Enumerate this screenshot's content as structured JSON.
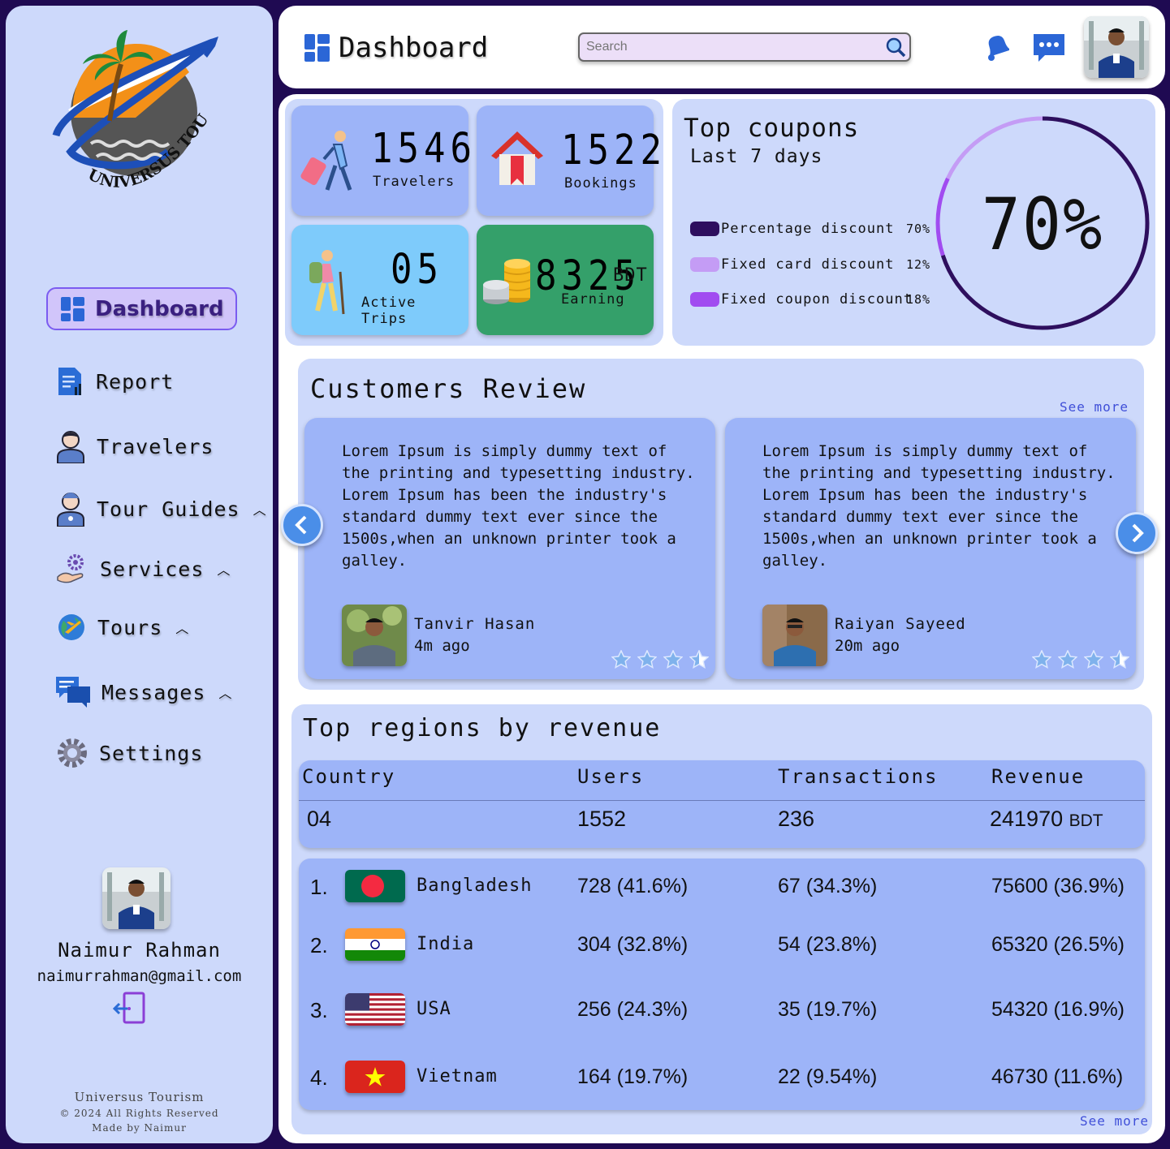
{
  "brand": {
    "logo_text": "UNIVERSUS TOURISM"
  },
  "sidebar": {
    "active": "Dashboard",
    "items": [
      {
        "label": "Report"
      },
      {
        "label": "Travelers"
      },
      {
        "label": "Tour Guides"
      },
      {
        "label": "Services"
      },
      {
        "label": "Tours"
      },
      {
        "label": "Messages"
      },
      {
        "label": "Settings"
      }
    ],
    "user": {
      "name": "Naimur Rahman",
      "email": "naimurrahman@gmail.com"
    },
    "footer": {
      "line1": "Universus Tourism",
      "line2": "© 2024 All Rights Reserved",
      "line3": "Made by Naimur"
    }
  },
  "header": {
    "title": "Dashboard",
    "search_placeholder": "Search"
  },
  "stats": [
    {
      "value": "1546",
      "label": "Travelers",
      "color": "#9db4f8"
    },
    {
      "value": "1522",
      "label": "Bookings",
      "color": "#9db4f8"
    },
    {
      "value": "05",
      "label": "Active Trips",
      "color": "#7ecbfb"
    },
    {
      "value": "8325",
      "unit": "BDT",
      "label": "Earning",
      "color": "#34a06a"
    }
  ],
  "coupons": {
    "title": "Top coupons",
    "subtitle": "Last 7 days",
    "items": [
      {
        "label": "Percentage discount",
        "pct": "70%",
        "color": "#2e0f5e"
      },
      {
        "label": "Fixed card discount",
        "pct": "12%",
        "color": "#c49cf5"
      },
      {
        "label": "Fixed coupon discount",
        "pct": "18%",
        "color": "#a14cf0"
      }
    ],
    "big_value": "70%"
  },
  "reviews": {
    "title": "Customers Review",
    "see_more": "See more",
    "items": [
      {
        "text": "Lorem Ipsum is simply dummy text of\nthe printing and typesetting industry.\nLorem Ipsum has been the industry's\nstandard dummy text ever since the\n1500s,when an unknown printer took a\ngalley.",
        "name": "Tanvir Hasan",
        "ago": "4m ago",
        "rating": 3.5
      },
      {
        "text": "Lorem Ipsum is simply dummy text of\nthe printing and typesetting industry.\nLorem Ipsum has been the industry's\nstandard dummy text ever since the\n1500s,when an unknown printer took a\ngalley.",
        "name": "Raiyan Sayeed",
        "ago": "20m ago",
        "rating": 3.5
      }
    ]
  },
  "regions": {
    "title": "Top regions by revenue",
    "columns": [
      "Country",
      "Users",
      "Transactions",
      "Revenue"
    ],
    "totals": {
      "country": "04",
      "users": "1552",
      "transactions": "236",
      "revenue": "241970",
      "revenue_unit": "BDT"
    },
    "rows": [
      {
        "rank": "1.",
        "country": "Bangladesh",
        "users": "728 (41.6%)",
        "transactions": "67 (34.3%)",
        "revenue": "75600 (36.9%)"
      },
      {
        "rank": "2.",
        "country": "India",
        "users": "304 (32.8%)",
        "transactions": "54 (23.8%)",
        "revenue": "65320 (26.5%)"
      },
      {
        "rank": "3.",
        "country": "USA",
        "users": "256 (24.3%)",
        "transactions": "35 (19.7%)",
        "revenue": "54320 (16.9%)"
      },
      {
        "rank": "4.",
        "country": "Vietnam",
        "users": "164 (19.7%)",
        "transactions": "22 (9.54%)",
        "revenue": "46730 (11.6%)"
      }
    ],
    "see_more": "See more"
  }
}
